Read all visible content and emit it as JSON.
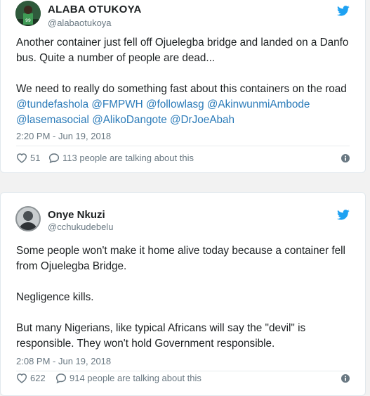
{
  "tweets": [
    {
      "name": "ALABA OTUKOYA",
      "handle": "@alabaotukoya",
      "paragraphs": [
        "Another container just fell off Ojuelegba bridge and landed on a Danfo bus. Quite a number of people are dead...",
        "We need to really do something fast about this containers on the road"
      ],
      "mentions": [
        "@tundefashola",
        "@FMPWH",
        "@followlasg",
        "@AkinwunmiAmbode",
        "@lasemasocial",
        "@AlikoDangote",
        "@DrJoeAbah"
      ],
      "time": "2:20 PM - Jun 19, 2018",
      "likes": "51",
      "talking": "113 people are talking about this"
    },
    {
      "name": "Onye Nkuzi",
      "handle": "@cchukudebelu",
      "paragraphs": [
        "Some people won't make it home alive today because a container fell from Ojuelegba Bridge.",
        "Negligence kills.",
        "But many Nigerians, like typical Africans will say the \"devil\" is responsible. They won't hold Government responsible."
      ],
      "time": "2:08 PM - Jun 19, 2018",
      "likes": "622",
      "talking": "914 people are talking about this"
    }
  ],
  "colors": {
    "twitter_blue": "#1da1f2",
    "mention": "#2b7bb9",
    "meta": "#697882"
  },
  "icons": [
    "twitter-bird-icon",
    "heart-icon",
    "speech-bubble-icon",
    "info-icon"
  ]
}
